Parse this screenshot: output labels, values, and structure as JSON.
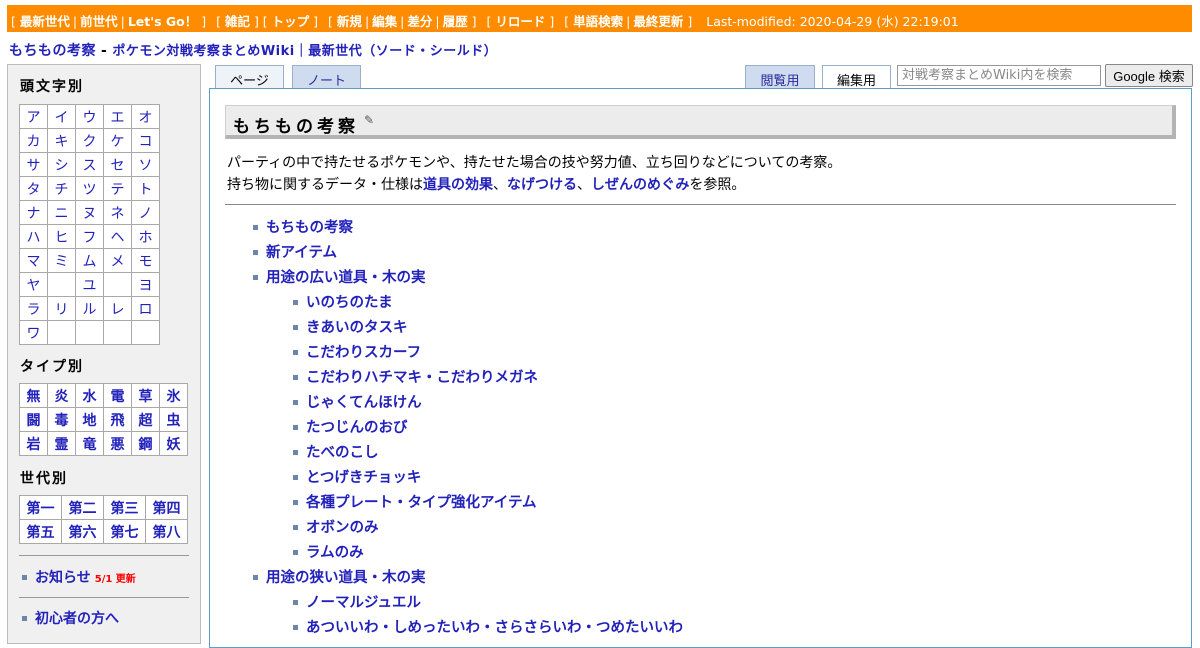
{
  "navbar": {
    "group1": [
      "最新世代",
      "前世代",
      "Let's Go！"
    ],
    "group2": [
      "雑記",
      "トップ"
    ],
    "group3": [
      "新規",
      "編集",
      "差分",
      "履歴"
    ],
    "group4": [
      "リロード"
    ],
    "group5": [
      "単語検索",
      "最終更新"
    ],
    "last_modified": "Last-modified: 2020-04-29 (水) 22:19:01",
    "bg_color": "#ff8c00"
  },
  "title": {
    "page_name": "もちもの考察",
    "separator": "-",
    "wiki_name": "ポケモン対戦考察まとめWiki｜最新世代（ソード・シールド）"
  },
  "sidebar": {
    "kana_heading": "頭文字別",
    "kana_rows": [
      [
        "ア",
        "イ",
        "ウ",
        "エ",
        "オ"
      ],
      [
        "カ",
        "キ",
        "ク",
        "ケ",
        "コ"
      ],
      [
        "サ",
        "シ",
        "ス",
        "セ",
        "ソ"
      ],
      [
        "タ",
        "チ",
        "ツ",
        "テ",
        "ト"
      ],
      [
        "ナ",
        "ニ",
        "ヌ",
        "ネ",
        "ノ"
      ],
      [
        "ハ",
        "ヒ",
        "フ",
        "ヘ",
        "ホ"
      ],
      [
        "マ",
        "ミ",
        "ム",
        "メ",
        "モ"
      ],
      [
        "ヤ",
        "",
        "ユ",
        "",
        "ヨ"
      ],
      [
        "ラ",
        "リ",
        "ル",
        "レ",
        "ロ"
      ],
      [
        "ワ",
        "",
        "",
        "",
        ""
      ]
    ],
    "type_heading": "タイプ別",
    "type_rows": [
      [
        "無",
        "炎",
        "水",
        "電",
        "草",
        "氷"
      ],
      [
        "闘",
        "毒",
        "地",
        "飛",
        "超",
        "虫"
      ],
      [
        "岩",
        "霊",
        "竜",
        "悪",
        "鋼",
        "妖"
      ]
    ],
    "gen_heading": "世代別",
    "gen_rows": [
      [
        "第一",
        "第二",
        "第三",
        "第四"
      ],
      [
        "第五",
        "第六",
        "第七",
        "第八"
      ]
    ],
    "news_label": "お知らせ",
    "news_badge": "5/1 更新",
    "beginner_label": "初心者の方へ"
  },
  "tabs": {
    "page": "ページ",
    "note": "ノート",
    "view": "閲覧用",
    "edit": "編集用"
  },
  "search": {
    "placeholder": "対戦考察まとめWiki内を検索",
    "button": "Google 検索"
  },
  "content": {
    "heading": "もちもの考察",
    "edit_icon": "pencil-icon",
    "intro_line1": "パーティの中で持たせるポケモンや、持たせた場合の技や努力値、立ち回りなどについての考察。",
    "intro_line2_pre": "持ち物に関するデータ・仕様は",
    "intro_link1": "道具の効果",
    "intro_sep1": "、",
    "intro_link2": "なげつける",
    "intro_sep2": "、",
    "intro_link3": "しぜんのめぐみ",
    "intro_line2_post": "を参照。",
    "toc": [
      {
        "level": 1,
        "label": "もちもの考察"
      },
      {
        "level": 1,
        "label": "新アイテム"
      },
      {
        "level": 1,
        "label": "用途の広い道具・木の実"
      },
      {
        "level": 2,
        "label": "いのちのたま"
      },
      {
        "level": 2,
        "label": "きあいのタスキ"
      },
      {
        "level": 2,
        "label": "こだわりスカーフ"
      },
      {
        "level": 2,
        "label": "こだわりハチマキ・こだわりメガネ"
      },
      {
        "level": 2,
        "label": "じゃくてんほけん"
      },
      {
        "level": 2,
        "label": "たつじんのおび"
      },
      {
        "level": 2,
        "label": "たべのこし"
      },
      {
        "level": 2,
        "label": "とつげきチョッキ"
      },
      {
        "level": 2,
        "label": "各種プレート・タイプ強化アイテム"
      },
      {
        "level": 2,
        "label": "オボンのみ"
      },
      {
        "level": 2,
        "label": "ラムのみ"
      },
      {
        "level": 1,
        "label": "用途の狭い道具・木の実"
      },
      {
        "level": 2,
        "label": "ノーマルジュエル"
      },
      {
        "level": 2,
        "label": "あついいわ・しめったいわ・さらさらいわ・つめたいいわ"
      }
    ]
  }
}
